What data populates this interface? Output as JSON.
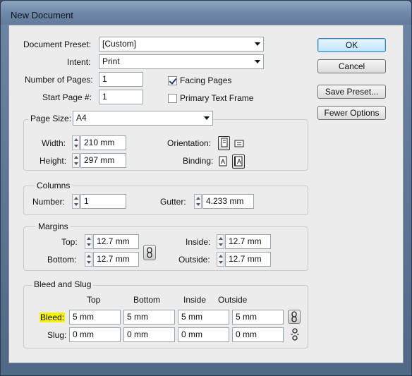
{
  "window": {
    "title": "New Document"
  },
  "buttons": {
    "ok": "OK",
    "cancel": "Cancel",
    "save_preset": "Save Preset...",
    "fewer_options": "Fewer Options"
  },
  "top": {
    "document_preset_label": "Document Preset:",
    "document_preset_value": "[Custom]",
    "intent_label": "Intent:",
    "intent_value": "Print",
    "number_of_pages_label": "Number of Pages:",
    "number_of_pages_value": "1",
    "start_page_label": "Start Page #:",
    "start_page_value": "1",
    "facing_pages_label": "Facing Pages",
    "facing_pages_checked": true,
    "primary_text_frame_label": "Primary Text Frame",
    "primary_text_frame_checked": false
  },
  "page_size": {
    "label": "Page Size:",
    "value": "A4",
    "width_label": "Width:",
    "width_value": "210 mm",
    "height_label": "Height:",
    "height_value": "297 mm",
    "orientation_label": "Orientation:",
    "binding_label": "Binding:"
  },
  "columns": {
    "title": "Columns",
    "number_label": "Number:",
    "number_value": "1",
    "gutter_label": "Gutter:",
    "gutter_value": "4.233 mm"
  },
  "margins": {
    "title": "Margins",
    "top_label": "Top:",
    "top_value": "12.7 mm",
    "bottom_label": "Bottom:",
    "bottom_value": "12.7 mm",
    "inside_label": "Inside:",
    "inside_value": "12.7 mm",
    "outside_label": "Outside:",
    "outside_value": "12.7 mm"
  },
  "bleed_slug": {
    "title": "Bleed and Slug",
    "headers": [
      "Top",
      "Bottom",
      "Inside",
      "Outside"
    ],
    "bleed_label": "Bleed:",
    "bleed_values": [
      "5 mm",
      "5 mm",
      "5 mm",
      "5 mm"
    ],
    "slug_label": "Slug:",
    "slug_values": [
      "0 mm",
      "0 mm",
      "0 mm",
      "0 mm"
    ],
    "highlight_color": "#f5f500"
  }
}
